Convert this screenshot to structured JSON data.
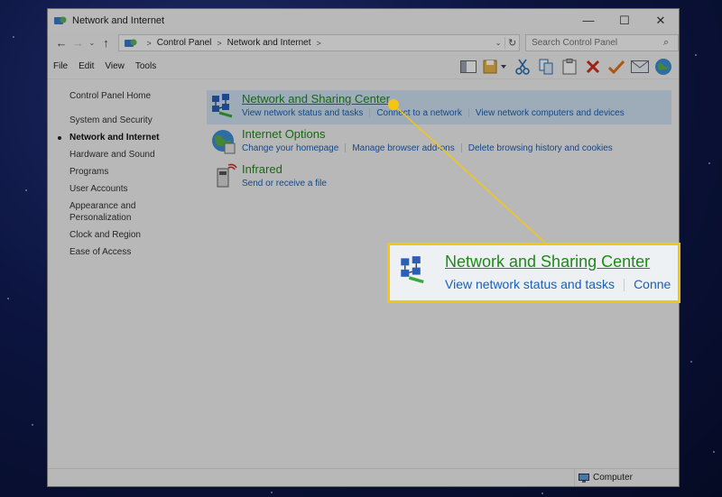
{
  "window": {
    "title": "Network and Internet",
    "controls": {
      "minimize": "—",
      "maximize": "☐",
      "close": "✕"
    }
  },
  "address_bar": {
    "back": "←",
    "forward": "→",
    "recent": "⌄",
    "up": "↑",
    "breadcrumbs": [
      "Control Panel",
      "Network and Internet"
    ],
    "crumb_separator": ">",
    "dropdown": "⌄",
    "refresh": "↻"
  },
  "search": {
    "placeholder": "Search Control Panel",
    "icon": "⌕"
  },
  "menu": {
    "items": [
      "File",
      "Edit",
      "View",
      "Tools"
    ]
  },
  "toolbar": {
    "buttons": [
      "panes-icon",
      "organize-icon",
      "cut-icon",
      "copy-icon",
      "paste-icon",
      "delete-icon",
      "check-icon",
      "mail-icon",
      "globe-icon"
    ]
  },
  "left_nav": {
    "home": "Control Panel Home",
    "items": [
      {
        "label": "System and Security",
        "current": false
      },
      {
        "label": "Network and Internet",
        "current": true
      },
      {
        "label": "Hardware and Sound",
        "current": false
      },
      {
        "label": "Programs",
        "current": false
      },
      {
        "label": "User Accounts",
        "current": false
      },
      {
        "label": "Appearance and Personalization",
        "current": false
      },
      {
        "label": "Clock and Region",
        "current": false
      },
      {
        "label": "Ease of Access",
        "current": false
      }
    ]
  },
  "categories": [
    {
      "title": "Network and Sharing Center",
      "links": [
        "View network status and tasks",
        "Connect to a network",
        "View network computers and devices"
      ]
    },
    {
      "title": "Internet Options",
      "links": [
        "Change your homepage",
        "Manage browser add-ons",
        "Delete browsing history and cookies"
      ]
    },
    {
      "title": "Infrared",
      "links": [
        "Send or receive a file"
      ]
    }
  ],
  "status_bar": {
    "location": "Computer"
  },
  "callout": {
    "title": "Network and Sharing Center",
    "links": [
      "View network status and tasks",
      "Conne"
    ]
  },
  "colors": {
    "highlight": "#f3c614",
    "link_green": "#1f8a17",
    "link_blue": "#1a5fb4",
    "selection": "#cfe3f2"
  }
}
